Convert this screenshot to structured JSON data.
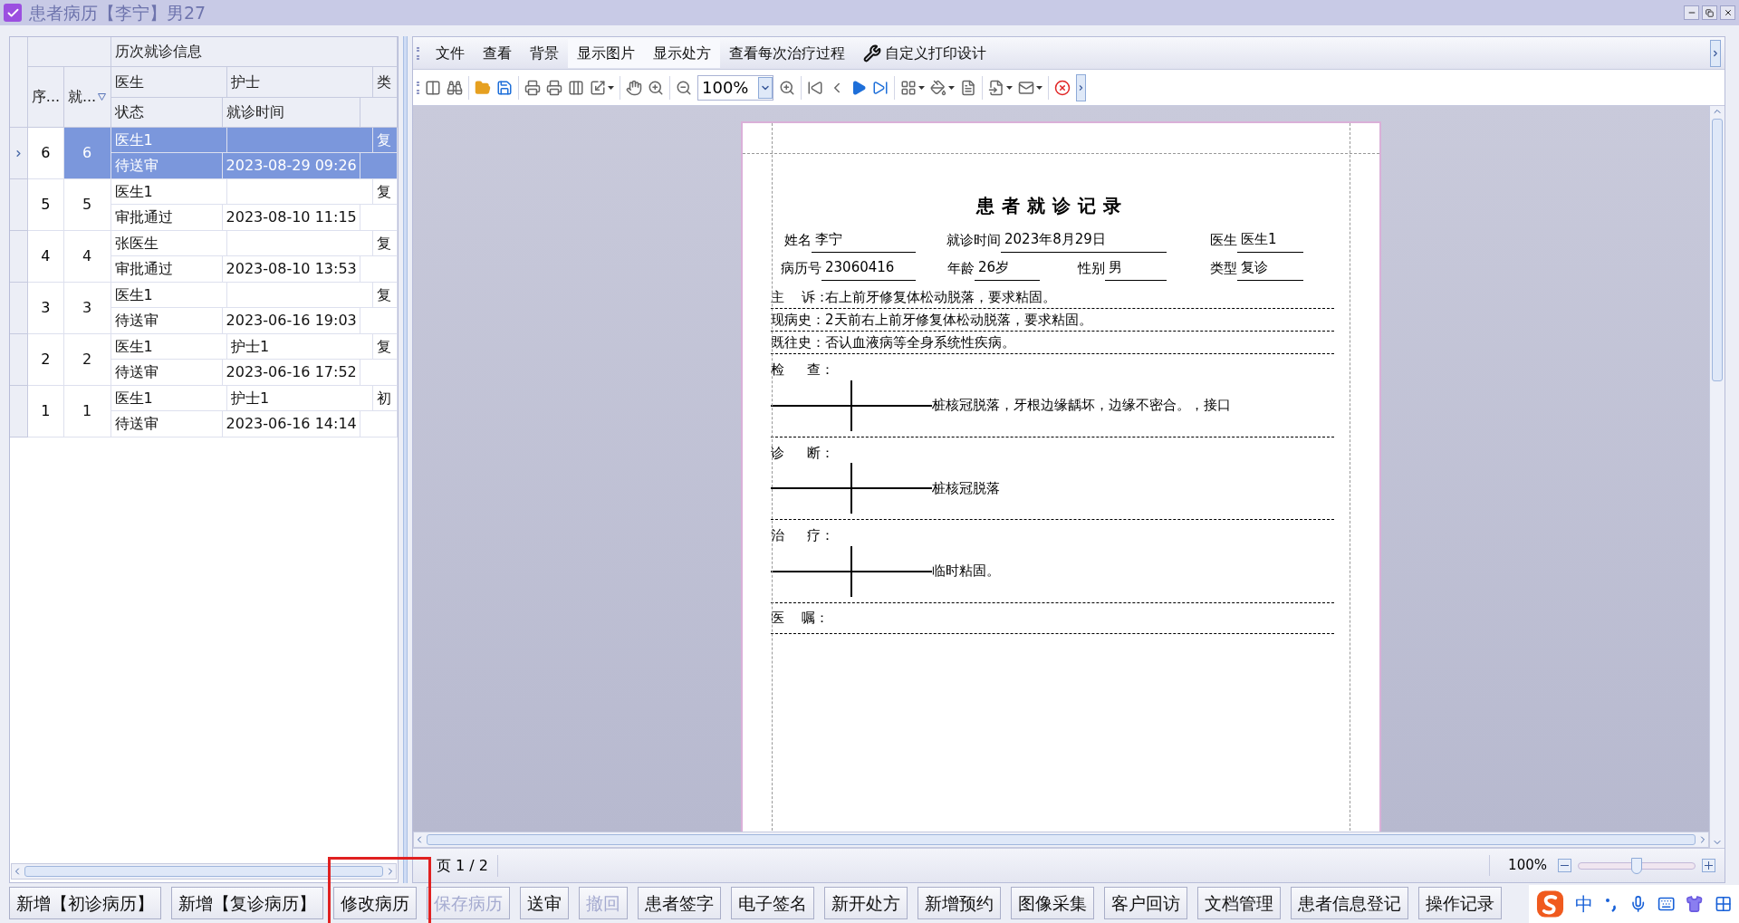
{
  "window": {
    "title": "患者病历【李宁】男27"
  },
  "visit_table": {
    "group_header": "历次就诊信息",
    "columns": {
      "seq": "序...",
      "visit_no": "就...",
      "doctor": "医生",
      "nurse": "护士",
      "type": "类",
      "status": "状态",
      "time": "就诊时间"
    },
    "rows": [
      {
        "seq": "6",
        "visit_no": "6",
        "doctor": "医生1",
        "type": "复",
        "status": "待送审",
        "time": "2023-08-29 09:26",
        "selected": true
      },
      {
        "seq": "5",
        "visit_no": "5",
        "doctor": "医生1",
        "type": "复",
        "status": "审批通过",
        "time": "2023-08-10 11:15",
        "selected": false
      },
      {
        "seq": "4",
        "visit_no": "4",
        "doctor": "张医生",
        "type": "复",
        "status": "审批通过",
        "time": "2023-08-10 13:53",
        "selected": false
      },
      {
        "seq": "3",
        "visit_no": "3",
        "doctor": "医生1",
        "type": "复",
        "status": "待送审",
        "time": "2023-06-16 19:03",
        "selected": false
      },
      {
        "seq": "2",
        "visit_no": "2",
        "doctor": "医生1",
        "nurse": "护士1",
        "type": "复",
        "status": "待送审",
        "time": "2023-06-16 17:52",
        "selected": false
      },
      {
        "seq": "1",
        "visit_no": "1",
        "doctor": "医生1",
        "nurse": "护士1",
        "type": "初",
        "status": "待送审",
        "time": "2023-06-16 14:14",
        "selected": false
      }
    ]
  },
  "menu": [
    {
      "label": "文件",
      "checked": false
    },
    {
      "label": "查看",
      "checked": false
    },
    {
      "label": "背景",
      "checked": false
    },
    {
      "label": "显示图片",
      "checked": true
    },
    {
      "label": "显示处方",
      "checked": true
    },
    {
      "label": "查看每次治疗过程",
      "checked": false
    },
    {
      "label": "自定义打印设计",
      "checked": false,
      "kind": "tools"
    }
  ],
  "toolbar": {
    "zoom": "100%"
  },
  "document": {
    "title": "患者就诊记录",
    "info_rows": [
      [
        {
          "label": "姓名",
          "value": "李宁"
        },
        {
          "label": "就诊时间",
          "value": "2023年8月29日"
        },
        {
          "label": "医生",
          "value": "医生1"
        }
      ],
      [
        {
          "label": "病历号",
          "value": "23060416"
        },
        {
          "label": "年龄",
          "value": "26岁"
        },
        {
          "label": "性别",
          "value": "男"
        },
        {
          "label": "类型",
          "value": "复诊"
        }
      ]
    ],
    "sections": [
      {
        "kind": "line",
        "label": "主 诉：",
        "text": "右上前牙修复体松动脱落，要求粘固。"
      },
      {
        "kind": "line",
        "label": "现病史：",
        "text": "2天前右上前牙修复体松动脱落，要求粘固。"
      },
      {
        "kind": "line",
        "label": "既往史：",
        "text": "否认血液病等全身系统性疾病。"
      },
      {
        "kind": "chart",
        "label": "检 查：",
        "text": "桩核冠脱落，牙根边缘龋坏，边缘不密合。，接口"
      },
      {
        "kind": "chart",
        "label": "诊 断：",
        "text": "桩核冠脱落"
      },
      {
        "kind": "chart",
        "label": "治 疗：",
        "text": "临时粘固。"
      },
      {
        "kind": "line",
        "label": "医 嘱："
      }
    ]
  },
  "status_bar": {
    "page": "页 1 / 2",
    "zoom": {
      "reading": "100%",
      "level": 0.5
    }
  },
  "bottom_buttons": [
    {
      "label": "新增【初诊病历】",
      "disabled": false
    },
    {
      "label": "新增【复诊病历】",
      "disabled": false
    },
    {
      "label": "修改病历",
      "disabled": false
    },
    {
      "label": "保存病历",
      "disabled": true
    },
    {
      "label": "送审",
      "disabled": false
    },
    {
      "label": "撤回",
      "disabled": true
    },
    {
      "label": "患者签字",
      "disabled": false
    },
    {
      "label": "电子签名",
      "disabled": false
    },
    {
      "label": "新开处方",
      "disabled": false
    },
    {
      "label": "新增预约",
      "disabled": false
    },
    {
      "label": "图像采集",
      "disabled": false
    },
    {
      "label": "客户回访",
      "disabled": false
    },
    {
      "label": "文档管理",
      "disabled": false
    },
    {
      "label": "患者信息登记",
      "disabled": false
    },
    {
      "label": "操作记录",
      "disabled": false
    }
  ],
  "ime": {
    "mode": "中"
  }
}
